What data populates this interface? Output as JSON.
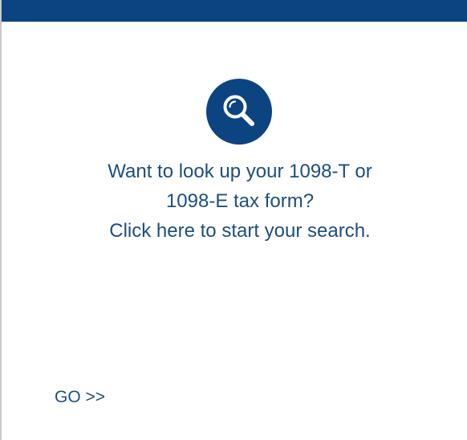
{
  "colors": {
    "brand": "#0c4482",
    "text": "#1c4f7f",
    "background": "#ffffff"
  },
  "icon": {
    "name": "search-icon"
  },
  "message": {
    "line1": "Want to look up your 1098-T or",
    "line2": "1098-E tax form?",
    "line3": "Click here to start your search."
  },
  "go_label": "GO >>"
}
